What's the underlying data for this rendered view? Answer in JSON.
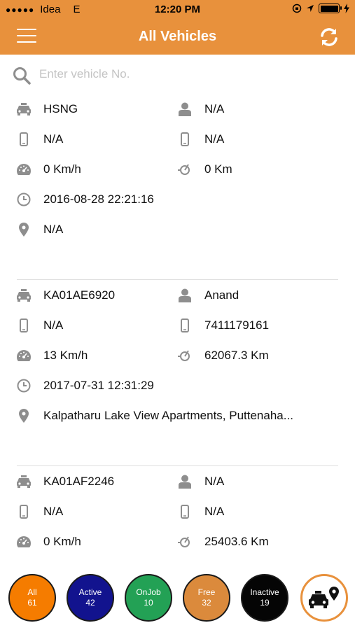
{
  "status_bar": {
    "carrier": "Idea",
    "network": "E",
    "time": "12:20 PM"
  },
  "nav": {
    "title": "All Vehicles",
    "menu_icon": "hamburger-menu-icon",
    "refresh_icon": "refresh-icon"
  },
  "search": {
    "placeholder": "Enter vehicle No.",
    "value": ""
  },
  "vehicles": [
    {
      "number": "HSNG",
      "driver": "N/A",
      "phone_1": "N/A",
      "phone_2": "N/A",
      "speed": "0 Km/h",
      "odometer": "0 Km",
      "timestamp": "2016-08-28 22:21:16",
      "location": "N/A"
    },
    {
      "number": "KA01AE6920",
      "driver": "Anand",
      "phone_1": "N/A",
      "phone_2": "7411179161",
      "speed": "13 Km/h",
      "odometer": "62067.3 Km",
      "timestamp": "2017-07-31 12:31:29",
      "location": "Kalpatharu Lake View Apartments, Puttenaha..."
    },
    {
      "number": "KA01AF2246",
      "driver": "N/A",
      "phone_1": "N/A",
      "phone_2": "N/A",
      "speed": "0 Km/h",
      "odometer": "25403.6 Km"
    }
  ],
  "filters": [
    {
      "label": "All",
      "count": "61"
    },
    {
      "label": "Active",
      "count": "42"
    },
    {
      "label": "OnJob",
      "count": "10"
    },
    {
      "label": "Free",
      "count": "32"
    },
    {
      "label": "Inactive",
      "count": "19"
    }
  ],
  "colors": {
    "accent": "#e8913c",
    "icon_gray": "#8e8e8e",
    "all": "#f57c00",
    "active": "#12138e",
    "onjob": "#23a155",
    "free": "#db8a3c",
    "inactive": "#050505"
  }
}
